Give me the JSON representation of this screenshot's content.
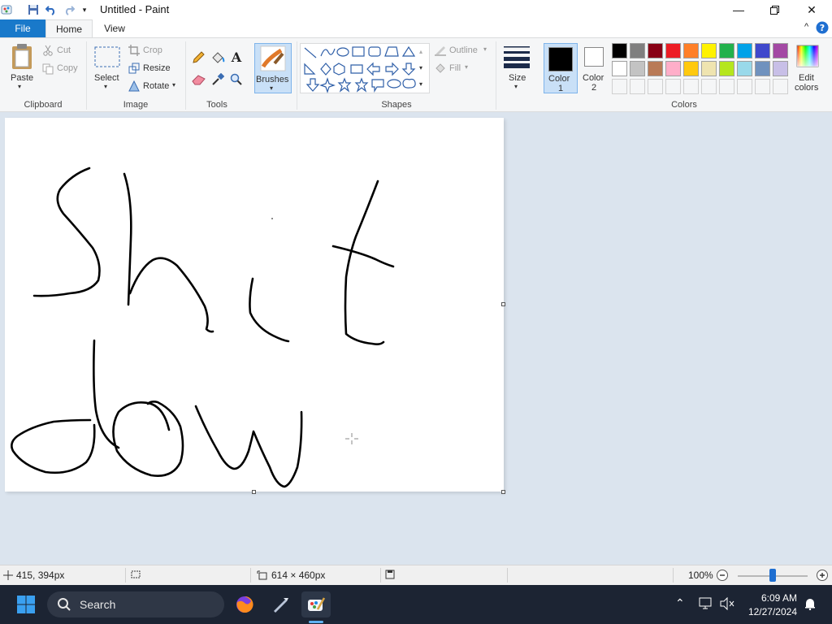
{
  "window": {
    "title": "Untitled - Paint"
  },
  "menu": {
    "file": "File",
    "home": "Home",
    "view": "View"
  },
  "ribbon": {
    "clipboard": {
      "paste": "Paste",
      "cut": "Cut",
      "copy": "Copy",
      "label": "Clipboard"
    },
    "image": {
      "select": "Select",
      "crop": "Crop",
      "resize": "Resize",
      "rotate": "Rotate",
      "label": "Image"
    },
    "tools": {
      "label": "Tools"
    },
    "brushes": {
      "label": "Brushes"
    },
    "shapes": {
      "outline": "Outline",
      "fill": "Fill",
      "label": "Shapes"
    },
    "size": {
      "label": "Size"
    },
    "colors": {
      "color1_line1": "Color",
      "color1_line2": "1",
      "color2_line1": "Color",
      "color2_line2": "2",
      "edit_line1": "Edit",
      "edit_line2": "colors",
      "label": "Colors",
      "color1_value": "#000000",
      "color2_value": "#ffffff",
      "palette_row1": [
        "#000000",
        "#7f7f7f",
        "#880015",
        "#ed1c24",
        "#ff7f27",
        "#fff200",
        "#22b14c",
        "#00a2e8",
        "#3f48cc",
        "#a349a4"
      ],
      "palette_row2": [
        "#ffffff",
        "#c3c3c3",
        "#b97a57",
        "#ffaec9",
        "#ffc90e",
        "#efe4b0",
        "#b5e61d",
        "#99d9ea",
        "#7092be",
        "#c8bfe7"
      ]
    }
  },
  "status": {
    "cursor_pos": "415, 394px",
    "canvas_size": "614 × 460px",
    "zoom": "100%",
    "zoom_level": 1.0
  },
  "taskbar": {
    "search": "Search",
    "time": "6:09 AM",
    "date": "12/27/2024"
  }
}
